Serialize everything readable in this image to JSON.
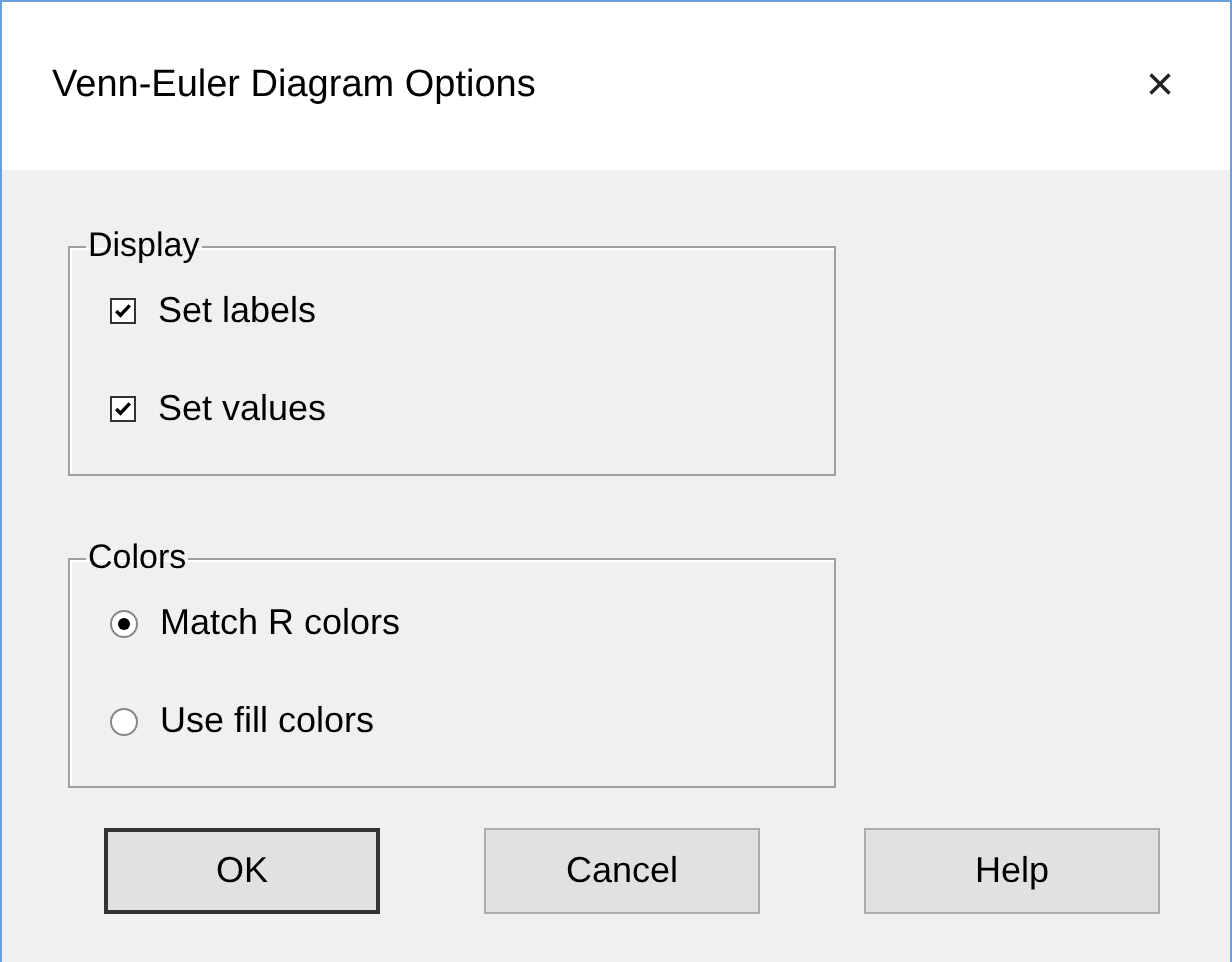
{
  "window": {
    "title": "Venn-Euler Diagram Options",
    "close": "×"
  },
  "display": {
    "title": "Display",
    "items": [
      {
        "label": "Set labels",
        "checked": true
      },
      {
        "label": "Set values",
        "checked": true
      }
    ]
  },
  "colors": {
    "title": "Colors",
    "items": [
      {
        "label": "Match R colors",
        "selected": true
      },
      {
        "label": "Use fill colors",
        "selected": false
      }
    ]
  },
  "buttons": [
    {
      "label": "OK",
      "default": true
    },
    {
      "label": "Cancel",
      "default": false
    },
    {
      "label": "Help",
      "default": false
    }
  ]
}
